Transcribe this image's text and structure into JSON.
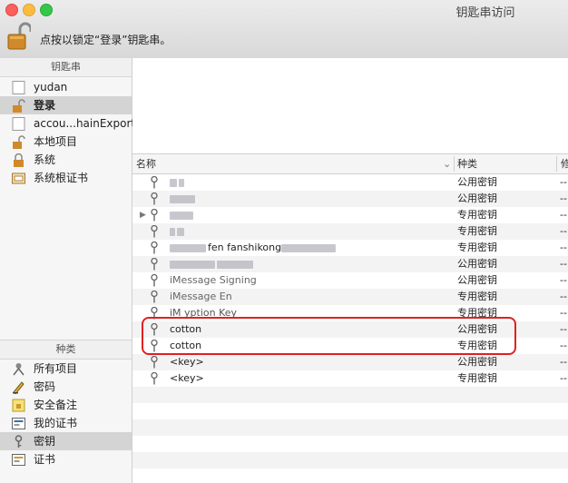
{
  "window": {
    "title": "钥匙串访问",
    "lock_hint": "点按以锁定“登录”钥匙串。",
    "lock_icon": "open-padlock-icon"
  },
  "sidebar": {
    "keychains_header": "钥匙串",
    "keychains": [
      {
        "label": "yudan",
        "icon": "keychain-file-icon"
      },
      {
        "label": "登录",
        "icon": "open-padlock-icon",
        "selected": true
      },
      {
        "label": "accou...hainExport",
        "icon": "keychain-file-icon"
      },
      {
        "label": "本地项目",
        "icon": "open-padlock-icon"
      },
      {
        "label": "系统",
        "icon": "closed-padlock-icon"
      },
      {
        "label": "系统根证书",
        "icon": "certificate-cabinet-icon"
      }
    ],
    "categories_header": "种类",
    "categories": [
      {
        "label": "所有项目",
        "icon": "all-items-icon"
      },
      {
        "label": "密码",
        "icon": "password-pen-icon"
      },
      {
        "label": "安全备注",
        "icon": "secure-note-icon"
      },
      {
        "label": "我的证书",
        "icon": "my-certificate-icon"
      },
      {
        "label": "密钥",
        "icon": "key-icon",
        "selected": true
      },
      {
        "label": "证书",
        "icon": "certificate-icon"
      }
    ]
  },
  "table": {
    "columns": {
      "name": "名称",
      "kind": "种类",
      "desc": "修"
    },
    "rows": [
      {
        "name": "",
        "kind": "公用密钥",
        "desc": "--"
      },
      {
        "name": "",
        "kind": "公用密钥",
        "desc": "--"
      },
      {
        "name": "",
        "kind": "专用密钥",
        "desc": "--"
      },
      {
        "name": "",
        "kind": "专用密钥",
        "desc": "--"
      },
      {
        "name": "fen   fanshikong",
        "kind": "专用密钥",
        "desc": "--"
      },
      {
        "name": "",
        "kind": "公用密钥",
        "desc": "--"
      },
      {
        "name": "iMessage Signing",
        "kind": "公用密钥",
        "desc": "--"
      },
      {
        "name": "iMessage En",
        "kind": "专用密钥",
        "desc": "--"
      },
      {
        "name": "iM        yption Key",
        "kind": "专用密钥",
        "desc": "--"
      },
      {
        "name": "cotton",
        "kind": "公用密钥",
        "desc": "--"
      },
      {
        "name": "cotton",
        "kind": "专用密钥",
        "desc": "--"
      },
      {
        "name": "<key>",
        "kind": "公用密钥",
        "desc": "--"
      },
      {
        "name": "<key>",
        "kind": "专用密钥",
        "desc": "--"
      }
    ]
  },
  "colors": {
    "highlight": "#e02020",
    "selection": "#d4d4d4"
  }
}
